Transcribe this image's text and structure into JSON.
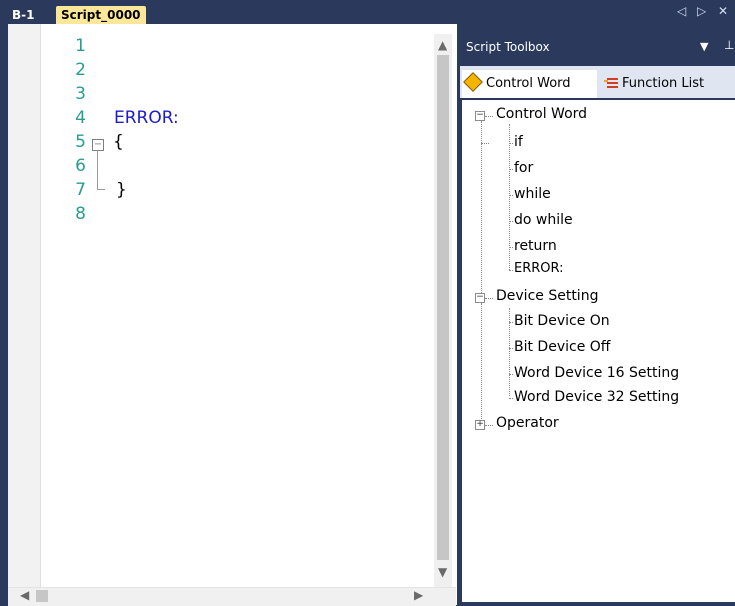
{
  "tabs": {
    "b1": "B-1",
    "script": "Script_0000"
  },
  "window_controls": {
    "prev": "◁",
    "next": "▷",
    "close": "✕"
  },
  "editor": {
    "line_numbers": [
      "1",
      "2",
      "3",
      "4",
      "5",
      "6",
      "7",
      "8"
    ],
    "code": {
      "line4": "ERROR:",
      "line5": "{",
      "line7": "}"
    },
    "colors": {
      "line_number": "#2a9d8f",
      "keyword": "#1c1cc8"
    }
  },
  "toolbox": {
    "title": "Script Toolbox",
    "tabs": {
      "control_word": "Control Word",
      "function_list": "Function List"
    },
    "tree": {
      "control_word": {
        "label": "Control Word",
        "children": [
          "if",
          "for",
          "while",
          "do while",
          "return",
          "ERROR:"
        ]
      },
      "device_setting": {
        "label": "Device Setting",
        "children": [
          "Bit Device On",
          "Bit Device Off",
          "Word Device 16 Setting",
          "Word Device 32 Setting"
        ]
      },
      "operator": {
        "label": "Operator"
      }
    }
  }
}
